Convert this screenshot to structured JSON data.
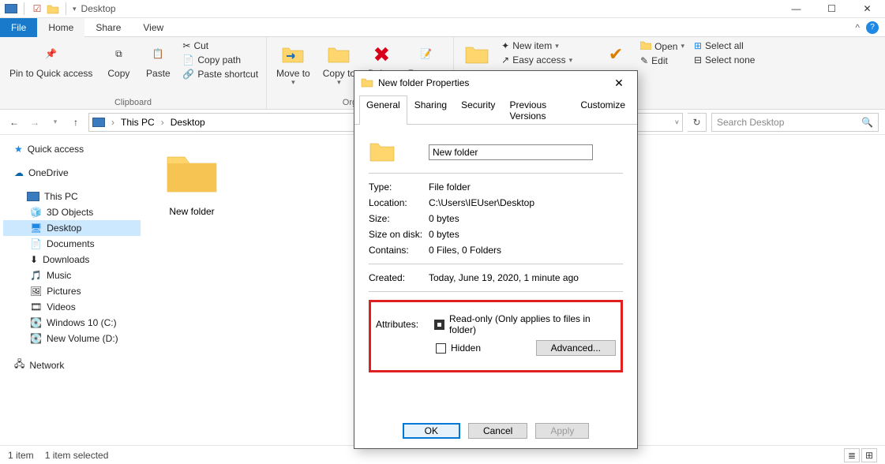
{
  "titlebar": {
    "title": "Desktop"
  },
  "tabs": {
    "file": "File",
    "home": "Home",
    "share": "Share",
    "view": "View"
  },
  "ribbon": {
    "clipboard": {
      "label": "Clipboard",
      "pin": "Pin to Quick access",
      "copy": "Copy",
      "paste": "Paste",
      "cut": "Cut",
      "copypath": "Copy path",
      "shortcut": "Paste shortcut"
    },
    "organize": {
      "label": "Organize",
      "moveto": "Move to",
      "copyto": "Copy to",
      "delete": "Delete",
      "rename": "Rename"
    },
    "new": {
      "newitem": "New item",
      "easyaccess": "Easy access"
    },
    "open": {
      "open": "Open",
      "edit": "Edit"
    },
    "select": {
      "selectall": "Select all",
      "selectnone": "Select none"
    }
  },
  "nav": {
    "crumb1": "This PC",
    "crumb2": "Desktop",
    "search_placeholder": "Search Desktop"
  },
  "sidebar": {
    "quick": "Quick access",
    "onedrive": "OneDrive",
    "thispc": "This PC",
    "items": [
      "3D Objects",
      "Desktop",
      "Documents",
      "Downloads",
      "Music",
      "Pictures",
      "Videos",
      "Windows 10 (C:)",
      "New Volume (D:)"
    ],
    "network": "Network"
  },
  "main": {
    "folder_name": "New folder"
  },
  "status": {
    "count": "1 item",
    "selected": "1 item selected"
  },
  "dialog": {
    "title": "New folder Properties",
    "tabs": [
      "General",
      "Sharing",
      "Security",
      "Previous Versions",
      "Customize"
    ],
    "name_value": "New folder",
    "type_label": "Type:",
    "type_value": "File folder",
    "loc_label": "Location:",
    "loc_value": "C:\\Users\\IEUser\\Desktop",
    "size_label": "Size:",
    "size_value": "0 bytes",
    "disk_label": "Size on disk:",
    "disk_value": "0 bytes",
    "contains_label": "Contains:",
    "contains_value": "0 Files, 0 Folders",
    "created_label": "Created:",
    "created_value": "Today, June 19, 2020, 1 minute ago",
    "attr_label": "Attributes:",
    "readonly": "Read-only (Only applies to files in folder)",
    "hidden": "Hidden",
    "advanced": "Advanced...",
    "ok": "OK",
    "cancel": "Cancel",
    "apply": "Apply"
  }
}
